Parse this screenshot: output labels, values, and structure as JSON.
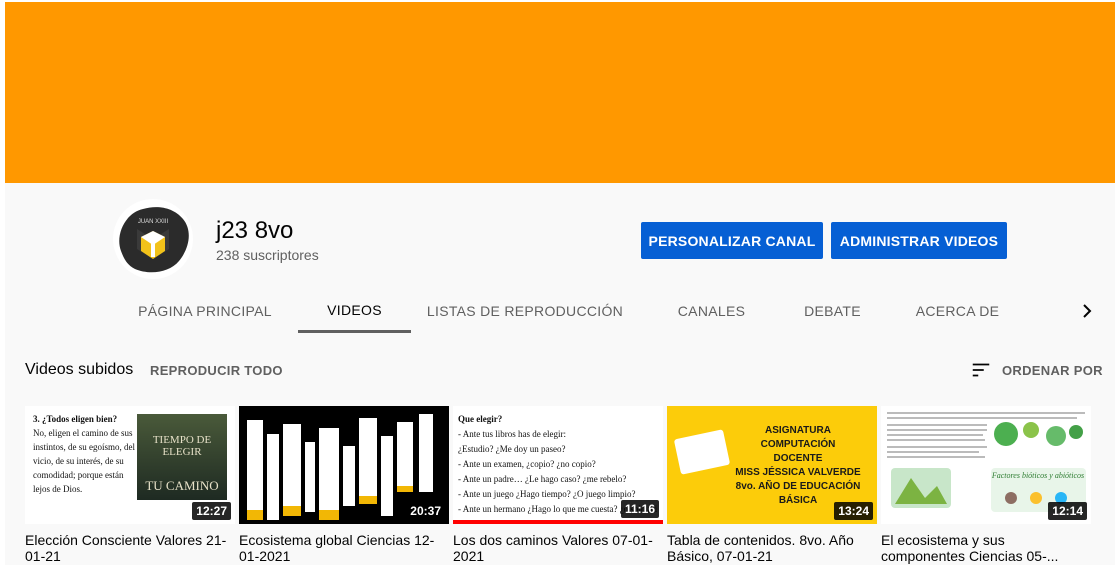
{
  "channel": {
    "name": "j23 8vo",
    "subscribers": "238 suscriptores",
    "banner_color": "#ff9800",
    "customize_label": "PERSONALIZAR CANAL",
    "manage_label": "ADMINISTRAR VIDEOS",
    "button_color": "#065fd4"
  },
  "tabs": [
    {
      "label": "PÁGINA PRINCIPAL",
      "active": false
    },
    {
      "label": "VIDEOS",
      "active": true
    },
    {
      "label": "LISTAS DE REPRODUCCIÓN",
      "active": false
    },
    {
      "label": "CANALES",
      "active": false
    },
    {
      "label": "DEBATE",
      "active": false
    },
    {
      "label": "ACERCA DE",
      "active": false
    }
  ],
  "tab_arrow_icon": "chevron-right-icon",
  "section": {
    "title": "Videos subidos",
    "play_all": "REPRODUCIR TODO",
    "sort_icon": "sort-icon",
    "sort_label": "ORDENAR POR"
  },
  "videos": [
    {
      "title": "Elección Consciente Valores 21-01-21",
      "duration": "12:27",
      "thumb": {
        "heading": "3. ¿Todos eligen bien?",
        "body": "No, eligen el camino de sus instintos, de su egoísmo, del vicio, de su interés, de su comodidad; porque están lejos de Dios.",
        "pic_title": "TIEMPO DE ELEGIR",
        "pic_sub": "TU CAMINO"
      }
    },
    {
      "title": "Ecosistema global Ciencias 12-01-2021",
      "duration": "20:37"
    },
    {
      "title": "Los dos caminos Valores 07-01-2021",
      "duration": "11:16",
      "watched_fraction": 1.0,
      "thumb": {
        "heading": "Que elegir?",
        "lines": [
          "- Ante tus libros has de elegir:",
          "¿Estudio?                      ¿Me doy un paseo?",
          "- Ante un examen, ¿copio? ¿no copio?",
          "- Ante un padre… ¿Le hago caso? ¿me rebelo?",
          "- Ante un juego ¿Hago tiempo? ¿O juego limpio?",
          "- Ante un hermano ¿Hago lo que me cuesta? ¿o solo mi gusto?"
        ]
      }
    },
    {
      "title": "Tabla de contenidos. 8vo. Año Básico, 07-01-21",
      "duration": "13:24",
      "thumb": {
        "lines": [
          "ASIGNATURA",
          "COMPUTACIÓN",
          "DOCENTE",
          "MISS JÉSSICA VALVERDE",
          "8vo. AÑO DE EDUCACIÓN BÁSICA"
        ]
      }
    },
    {
      "title": "El ecosistema y sus componentes Ciencias 05-...",
      "duration": "12:14",
      "thumb": {
        "badge": "Factores bióticos y abióticos"
      }
    }
  ]
}
